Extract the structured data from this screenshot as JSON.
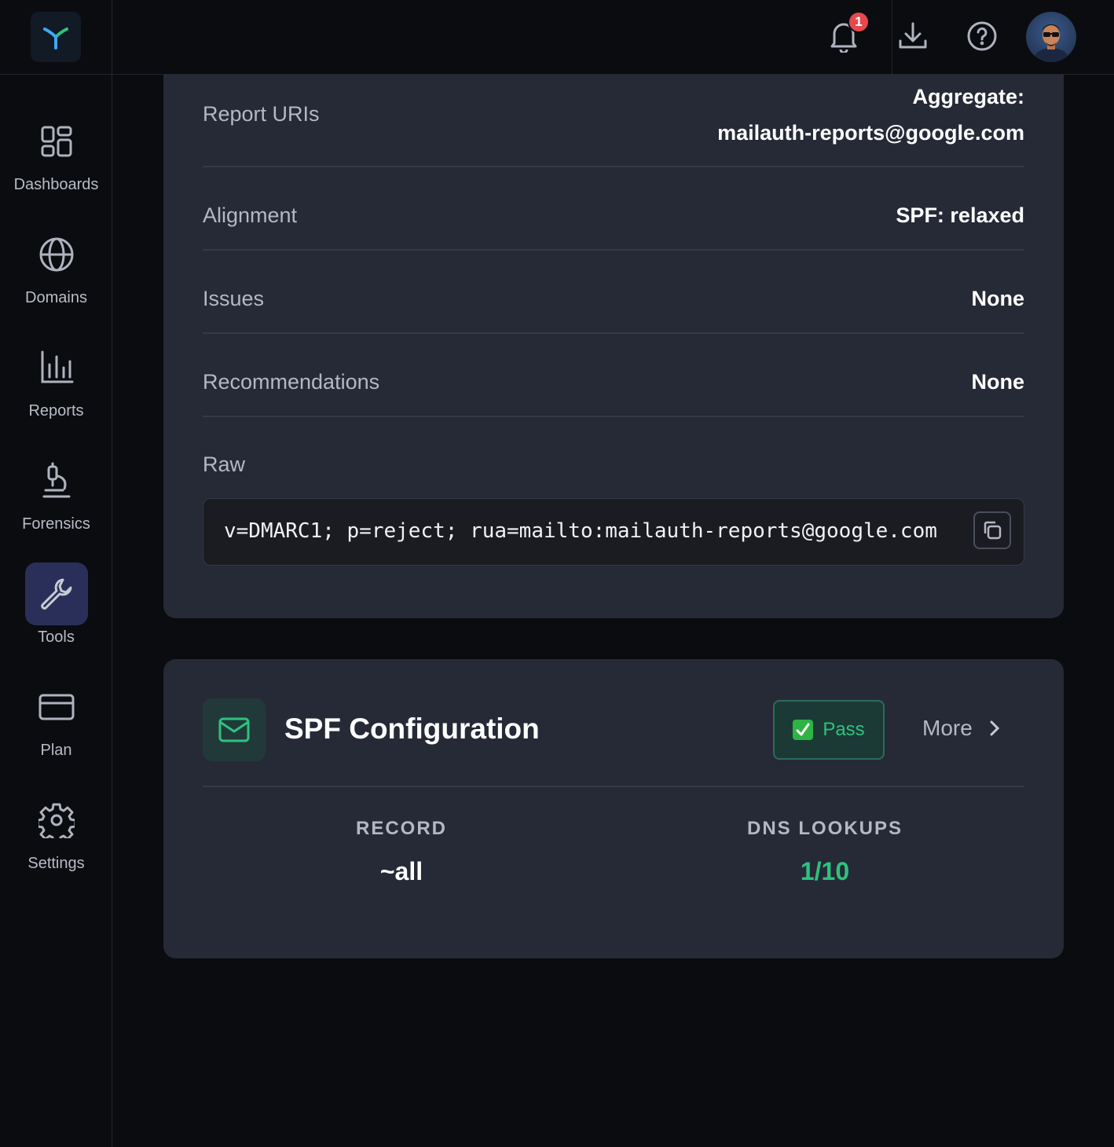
{
  "nav": {
    "items": [
      {
        "label": "Dashboards",
        "icon": "dashboard-grid-icon"
      },
      {
        "label": "Domains",
        "icon": "globe-icon"
      },
      {
        "label": "Reports",
        "icon": "bar-chart-icon"
      },
      {
        "label": "Forensics",
        "icon": "microscope-icon"
      },
      {
        "label": "Tools",
        "icon": "wrench-icon",
        "active": true
      },
      {
        "label": "Plan",
        "icon": "credit-card-icon"
      },
      {
        "label": "Settings",
        "icon": "gear-icon"
      }
    ]
  },
  "topbar": {
    "notification_count": "1"
  },
  "dmarc": {
    "rows": [
      {
        "label": "Report URIs",
        "value_heading": "Aggregate:",
        "value": "mailauth-reports@google.com"
      },
      {
        "label": "Alignment",
        "value": "SPF: relaxed"
      },
      {
        "label": "Issues",
        "value": "None"
      },
      {
        "label": "Recommendations",
        "value": "None"
      }
    ],
    "raw_label": "Raw",
    "raw_value": "v=DMARC1; p=reject; rua=mailto:mailauth-reports@google.com"
  },
  "spf": {
    "title": "SPF Configuration",
    "status": "Pass",
    "more_label": "More",
    "stats": [
      {
        "label": "RECORD",
        "value": "~all"
      },
      {
        "label": "DNS LOOKUPS",
        "value": "1/10"
      }
    ]
  },
  "colors": {
    "accent": "#2ec27e",
    "card": "#262a36",
    "background": "#0b0c10",
    "badge": "#e5484d"
  }
}
